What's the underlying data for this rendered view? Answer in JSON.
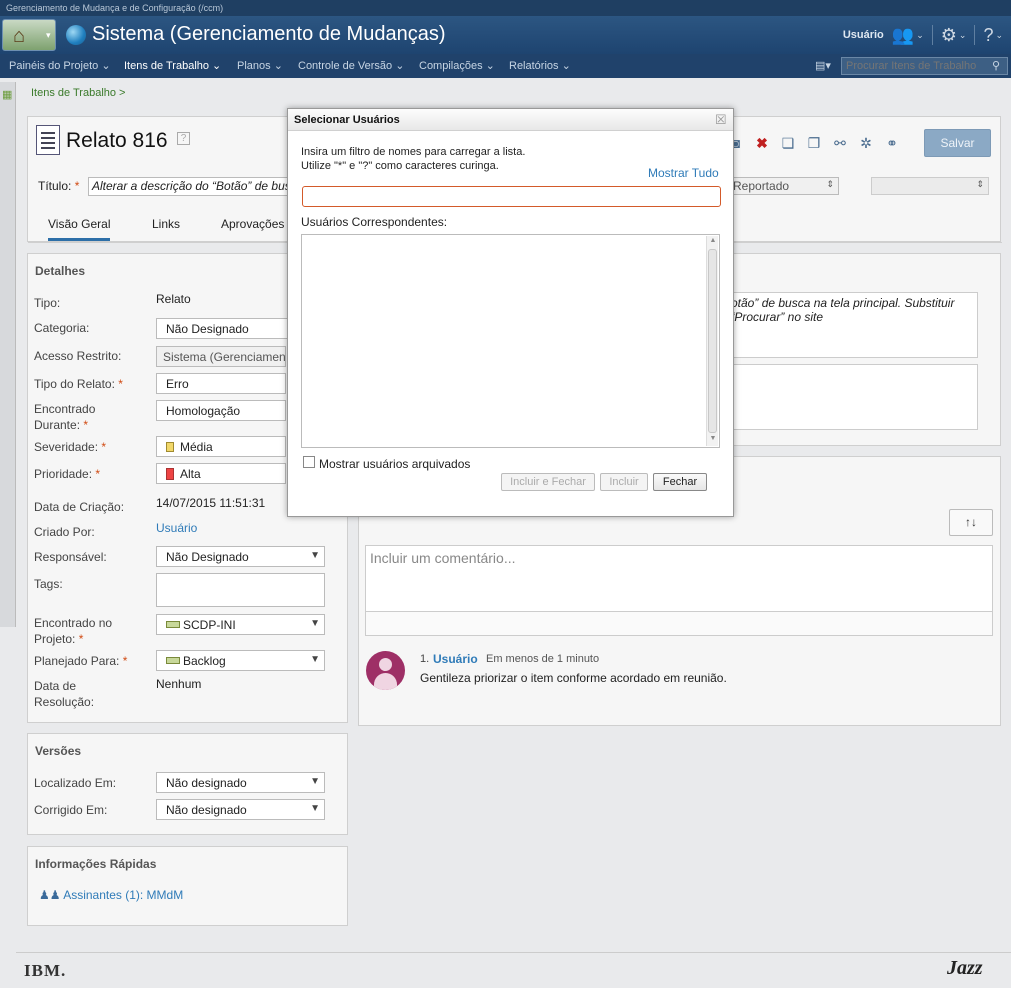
{
  "app_strip": "Gerenciamento de Mudança e de Configuração (/ccm)",
  "title_bar": {
    "title": "Sistema (Gerenciamento de Mudanças)",
    "user_label": "Usuário"
  },
  "nav": {
    "items": [
      "Painéis do Projeto ⌄",
      "Itens de Trabalho ⌄",
      "Planos ⌄",
      "Controle de Versão ⌄",
      "Compilações ⌄",
      "Relatórios ⌄"
    ],
    "search_placeholder": "Procurar Itens de Trabalho"
  },
  "breadcrumb": "Itens de Trabalho >",
  "work_item": {
    "title": "Relato 816",
    "title_label": "Título:",
    "title_value": "Alterar a descrição do “Botão” de busca",
    "status_value": "Reportado",
    "save_label": "Salvar",
    "tabs": [
      "Visão Geral",
      "Links",
      "Aprovações"
    ]
  },
  "details": {
    "title": "Detalhes",
    "fields": {
      "tipo_label": "Tipo:",
      "tipo_value": "Relato",
      "categoria_label": "Categoria:",
      "categoria_value": "Não Designado",
      "acesso_label": "Acesso Restrito:",
      "acesso_value": "Sistema (Gerenciamento de Mudanças)",
      "tipo_relato_label": "Tipo do Relato:",
      "tipo_relato_value": "Erro",
      "encontrado_label_1": "Encontrado",
      "encontrado_label_2": "Durante:",
      "encontrado_value": "Homologação",
      "severidade_label": "Severidade:",
      "severidade_value": "Média",
      "prioridade_label": "Prioridade:",
      "prioridade_value": "Alta",
      "data_criacao_label": "Data de Criação:",
      "data_criacao_value": "14/07/2015 11:51:31",
      "criado_por_label": "Criado Por:",
      "criado_por_value": "Usuário",
      "responsavel_label": "Responsável:",
      "responsavel_value": "Não Designado",
      "tags_label": "Tags:",
      "projeto_label_1": "Encontrado no",
      "projeto_label_2": "Projeto:",
      "projeto_value": "SCDP-INI",
      "planejado_label": "Planejado Para:",
      "planejado_value": "Backlog",
      "resolucao_label_1": "Data de",
      "resolucao_label_2": "Resolução:",
      "resolucao_value": "Nenhum"
    }
  },
  "versions": {
    "title": "Versões",
    "localizado_label": "Localizado Em:",
    "localizado_value": "Não designado",
    "corrigido_label": "Corrigido Em:",
    "corrigido_value": "Não designado"
  },
  "quick_info": {
    "title": "Informações Rápidas",
    "subscribers": "Assinantes (1):  MMdM"
  },
  "description": {
    "text_1": "Botão” de busca na tela principal. Substituir",
    "text_2": "r “Procurar” no site"
  },
  "comments": {
    "placeholder": "Incluir um comentário...",
    "items": [
      {
        "num": "1.",
        "user": "Usuário",
        "time": "Em menos de 1 minuto",
        "text": "Gentileza priorizar o item conforme acordado em reunião."
      }
    ]
  },
  "dialog": {
    "title": "Selecionar Usuários",
    "instruction_1": "Insira um filtro de nomes para carregar a lista.",
    "instruction_2": "Utilize \"*\" e \"?\" como caracteres curinga.",
    "show_all": "Mostrar Tudo",
    "filter_value": "",
    "matching_label": "Usuários Correspondentes:",
    "show_archived": "Mostrar usuários arquivados",
    "buttons": {
      "include_close": "Incluir e Fechar",
      "include": "Incluir",
      "close": "Fechar"
    }
  },
  "footer": {
    "ibm": "IBM.",
    "jazz": "Jazz"
  },
  "colors": {
    "accent": "#2f7bb8",
    "title_bar": "#2c5682",
    "nav_bar": "#20426b",
    "required": "#d04a12"
  }
}
